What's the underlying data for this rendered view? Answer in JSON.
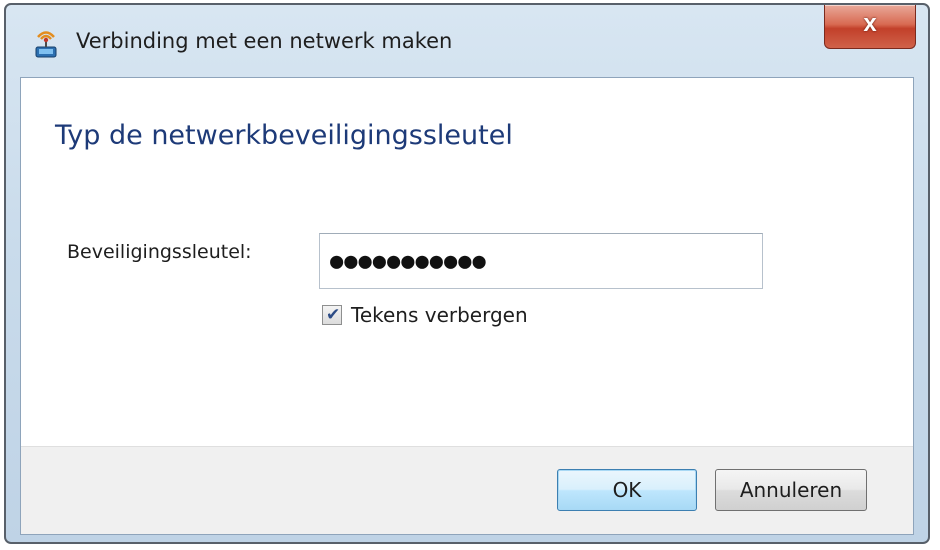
{
  "window": {
    "title": "Verbinding met een netwerk maken",
    "close_glyph": "x"
  },
  "main": {
    "heading": "Typ de netwerkbeveiligingssleutel",
    "key_label": "Beveiligingssleutel:",
    "key_value": "●●●●●●●●●●●",
    "hide_chars_label": "Tekens verbergen",
    "hide_chars_checked": true
  },
  "footer": {
    "ok_label": "OK",
    "cancel_label": "Annuleren"
  },
  "colors": {
    "heading": "#1d3a78",
    "close_button": "#c2402a",
    "ok_border": "#3c7fb1"
  },
  "icons": {
    "title": "network-connect-icon",
    "close": "close-icon",
    "check": "checkmark-icon"
  }
}
